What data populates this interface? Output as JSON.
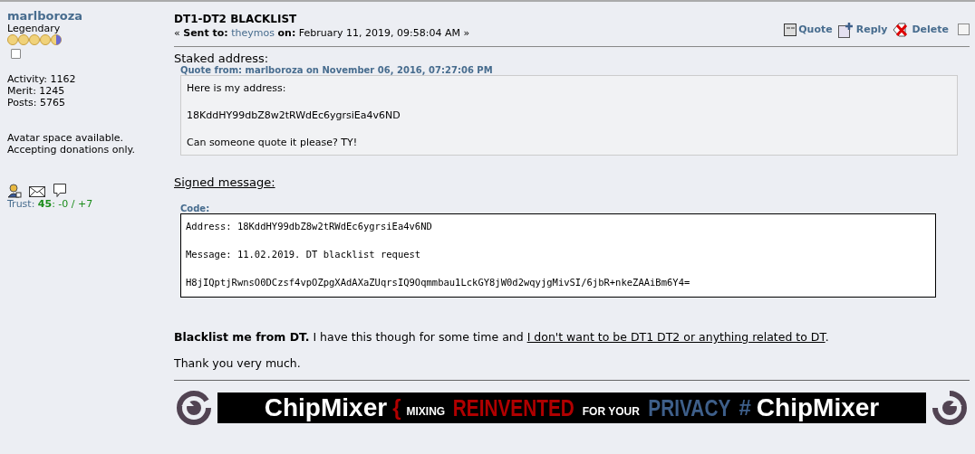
{
  "poster": {
    "name": "marlboroza",
    "rank": "Legendary",
    "coins": [
      {
        "kind": "gold"
      },
      {
        "kind": "gold"
      },
      {
        "kind": "gold"
      },
      {
        "kind": "gold"
      },
      {
        "kind": "half"
      }
    ],
    "stats": [
      "Activity: 1162",
      "Merit: 1245",
      "Posts: 5765"
    ],
    "avatar_note": [
      "Avatar space available.",
      "Accepting donations only."
    ],
    "trust": {
      "label": "Trust:",
      "score": "45",
      "rest": ": -0 / +7"
    }
  },
  "message": {
    "title": "DT1-DT2 BLACKLIST",
    "open": "«",
    "sent_to_label": "Sent to:",
    "recipient": "theymos",
    "on_label": "on:",
    "date": "February 11, 2019, 09:58:04 AM",
    "close": "»",
    "actions": [
      {
        "kind": "quote",
        "label": "Quote"
      },
      {
        "kind": "reply",
        "label": "Reply"
      },
      {
        "kind": "delete",
        "label": "Delete"
      }
    ],
    "select_checked": false,
    "intro": "Staked address:",
    "quote_header": "Quote from: marlboroza on November 06, 2016, 07:27:06 PM",
    "quote_lines": [
      "Here is my address:",
      "18KddHY99dbZ8w2tRWdEc6ygrsiEa4v6ND",
      "Can someone quote it please? TY!"
    ],
    "signed_heading": "Signed message:",
    "code_header": "Code:",
    "code_lines": [
      "Address: 18KddHY99dbZ8w2tRWdEc6ygrsiEa4v6ND",
      "Message: 11.02.2019. DT blacklist request",
      "H8jIQptjRwnsO0DCzsf4vpOZpgXAdAXaZUqrsIQ9Oqmmbau1LckGY8jW0d2wqyjgMivSI/6jbR+nkeZAAiBm6Y4="
    ],
    "paragraph": [
      {
        "kind": "bold",
        "text": "Blacklist me from DT."
      },
      {
        "kind": "plain",
        "text": " I have this though for some time and "
      },
      {
        "kind": "underline",
        "text": "I don't want to be DT1 DT2 or anything related to DT"
      },
      {
        "kind": "plain",
        "text": "."
      }
    ],
    "thanks": "Thank you very much.",
    "banner": [
      {
        "kind": "brand",
        "text": "ChipMixer"
      },
      {
        "kind": "brace",
        "text": "{"
      },
      {
        "kind": "small",
        "text": "MIXING"
      },
      {
        "kind": "redword",
        "text": "REINVENTED"
      },
      {
        "kind": "small",
        "text": "FOR YOUR"
      },
      {
        "kind": "blueword",
        "text": "PRIVACY"
      },
      {
        "kind": "hash",
        "text": "#"
      },
      {
        "kind": "brand",
        "text": "ChipMixer"
      }
    ]
  }
}
